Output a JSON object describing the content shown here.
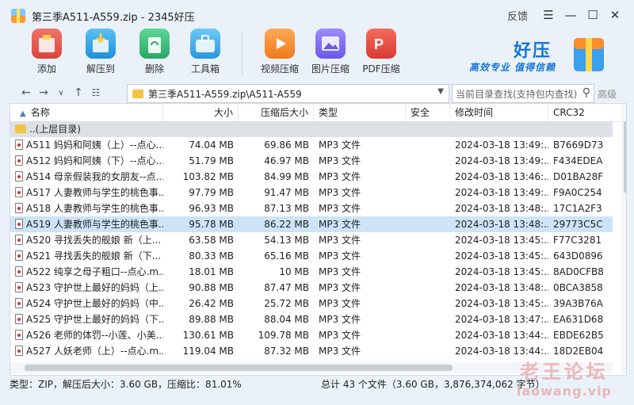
{
  "window": {
    "title": "第三季A511-A559.zip - 2345好压",
    "feedback": "反馈"
  },
  "toolbar": {
    "items": [
      {
        "label": "添加",
        "icon": "add-archive-icon",
        "color": "#e75b4f"
      },
      {
        "label": "解压到",
        "icon": "extract-icon",
        "color": "#2fa4e8"
      },
      {
        "label": "删除",
        "icon": "recycle-icon",
        "color": "#3cc07b"
      },
      {
        "label": "工具箱",
        "icon": "toolbox-icon",
        "color": "#35a8e6"
      },
      {
        "label": "视频压缩",
        "icon": "video-compress-icon",
        "color": "#f28a2c"
      },
      {
        "label": "图片压缩",
        "icon": "image-compress-icon",
        "color": "#7a6bf0"
      },
      {
        "label": "PDF压缩",
        "icon": "pdf-compress-icon",
        "color": "#ea4b3f"
      }
    ]
  },
  "brand": {
    "name": "好压",
    "slogan": "高效专业 值得信赖"
  },
  "navbar": {
    "path": "第三季A511-A559.zip\\A511-A559",
    "search_placeholder": "当前目录查找(支持包内查找)",
    "advanced": "高级"
  },
  "columns": [
    "名称",
    "大小",
    "压缩后大小",
    "类型",
    "安全",
    "修改时间",
    "CRC32"
  ],
  "up_row": "..(上层目录)",
  "rows": [
    [
      "A511 妈妈和阿姨（上）--点心...",
      "74.04 MB",
      "69.86 MB",
      "MP3 文件",
      "",
      "2024-03-18 13:49:...",
      "B7669D73"
    ],
    [
      "A512 妈妈和阿姨（下）--点心...",
      "51.79 MB",
      "46.97 MB",
      "MP3 文件",
      "",
      "2024-03-18 13:49:...",
      "F434EDEA"
    ],
    [
      "A514 母亲假装我的女朋友--点...",
      "103.82 MB",
      "84.99 MB",
      "MP3 文件",
      "",
      "2024-03-18 13:46:...",
      "D01BA28F"
    ],
    [
      "A517 人妻教师与学生的桃色事...",
      "97.79 MB",
      "91.47 MB",
      "MP3 文件",
      "",
      "2024-03-18 13:49:...",
      "F9A0C254"
    ],
    [
      "A518 人妻教师与学生的桃色事...",
      "96.93 MB",
      "87.13 MB",
      "MP3 文件",
      "",
      "2024-03-18 13:48:...",
      "17C1A2F3"
    ],
    [
      "A519 人妻教师与学生的桃色事...",
      "95.78 MB",
      "86.22 MB",
      "MP3 文件",
      "",
      "2024-03-18 13:48:...",
      "29773C5C"
    ],
    [
      "A520 寻找丢失的舰娘 新（上...",
      "63.58 MB",
      "54.13 MB",
      "MP3 文件",
      "",
      "2024-03-18 13:45:...",
      "F77C3281"
    ],
    [
      "A521 寻找丢失的舰娘 新（下...",
      "80.33 MB",
      "65.16 MB",
      "MP3 文件",
      "",
      "2024-03-18 13:45:...",
      "643D0896"
    ],
    [
      "A522 纯享之母子粗口--点心.m...",
      "18.01 MB",
      "10 MB",
      "MP3 文件",
      "",
      "2024-03-18 13:45:...",
      "8AD0CFB8"
    ],
    [
      "A523 守护世上最好的妈妈（上...",
      "90.88 MB",
      "87.47 MB",
      "MP3 文件",
      "",
      "2024-03-18 13:48:...",
      "0BCA3858"
    ],
    [
      "A524 守护世上最好的妈妈（中...",
      "26.42 MB",
      "25.72 MB",
      "MP3 文件",
      "",
      "2024-03-18 13:45:...",
      "39A3B76A"
    ],
    [
      "A525 守护世上最好的妈妈（下...",
      "89.88 MB",
      "88.04 MB",
      "MP3 文件",
      "",
      "2024-03-18 13:47:...",
      "EA631D68"
    ],
    [
      "A526 老师的体罚--小莲、小美...",
      "130.61 MB",
      "109.78 MB",
      "MP3 文件",
      "",
      "2024-03-18 13:44:...",
      "EBDE62B5"
    ],
    [
      "A527 人妖老师（上）--点心.m...",
      "119.04 MB",
      "87.32 MB",
      "MP3 文件",
      "",
      "2024-03-18 13:44:...",
      "18D2EB04"
    ]
  ],
  "selected_row": 5,
  "status": {
    "left": "类型：ZIP，解压后大小：3.60 GB，压缩比：81.01%",
    "right": "总计 43 个文件（3.60 GB，3,876,374,062 字节）"
  },
  "watermark": {
    "line1": "老王论坛",
    "line2": "laowang.vip"
  }
}
